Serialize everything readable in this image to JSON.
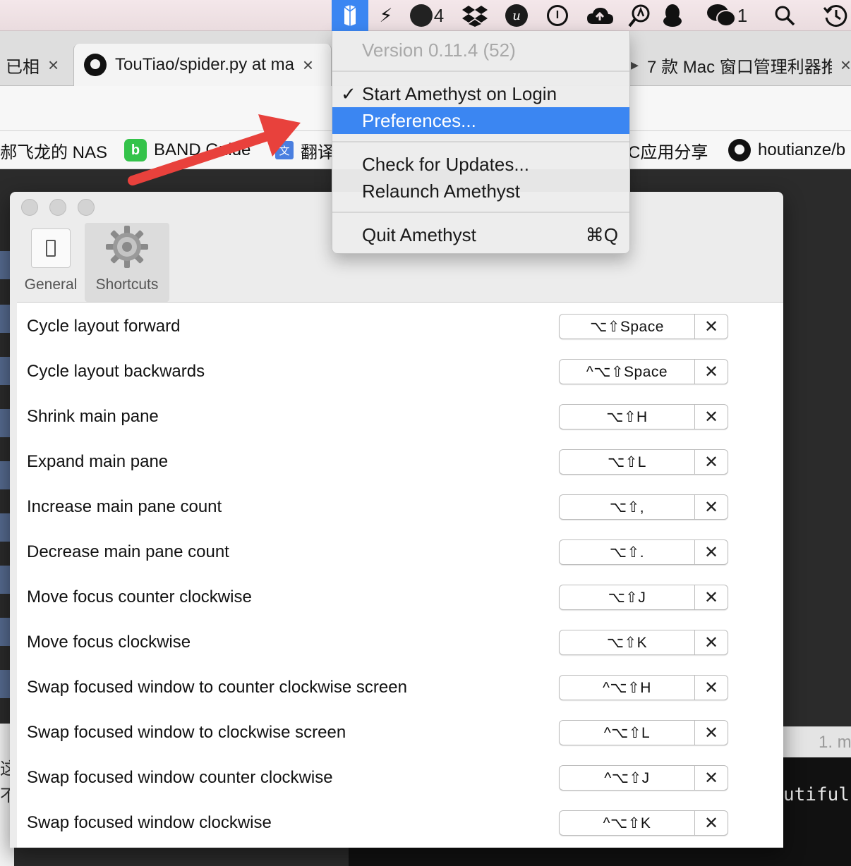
{
  "menubar": {
    "bolt_icon": "⚡",
    "extras_count": "4",
    "wechat_count": "1"
  },
  "tabs": {
    "left_partial": "已相",
    "github_tab": "TouTiao/spider.py at ma",
    "right_tab": "7 款 Mac 窗口管理利器推",
    "close": "×"
  },
  "bookmarks": {
    "nas": "郝飞龙的 NAS",
    "band": "BAND Guide",
    "translate": "翻译",
    "mac_app": "C应用分享",
    "github_user": "houtianze/b"
  },
  "menu": {
    "version": "Version 0.11.4 (52)",
    "start_on_login": "Start Amethyst on Login",
    "checkmark": "✓",
    "preferences": "Preferences...",
    "check_updates": "Check for Updates...",
    "relaunch": "Relaunch Amethyst",
    "quit": "Quit Amethyst",
    "quit_shortcut": "⌘Q"
  },
  "prefs": {
    "tabs": [
      {
        "label": "General"
      },
      {
        "label": "Shortcuts"
      }
    ],
    "clear_label": "✕",
    "shortcuts": [
      {
        "label": "Cycle layout forward",
        "keys": "⌥⇧Space"
      },
      {
        "label": "Cycle layout backwards",
        "keys": "^⌥⇧Space"
      },
      {
        "label": "Shrink main pane",
        "keys": "⌥⇧H"
      },
      {
        "label": "Expand main pane",
        "keys": "⌥⇧L"
      },
      {
        "label": "Increase main pane count",
        "keys": "⌥⇧,"
      },
      {
        "label": "Decrease main pane count",
        "keys": "⌥⇧."
      },
      {
        "label": "Move focus counter clockwise",
        "keys": "⌥⇧J"
      },
      {
        "label": "Move focus clockwise",
        "keys": "⌥⇧K"
      },
      {
        "label": "Swap focused window to counter clockwise screen",
        "keys": "^⌥⇧H"
      },
      {
        "label": "Swap focused window to clockwise screen",
        "keys": "^⌥⇧L"
      },
      {
        "label": "Swap focused window counter clockwise",
        "keys": "^⌥⇧J"
      },
      {
        "label": "Swap focused window clockwise",
        "keys": "^⌥⇧K"
      }
    ]
  },
  "background": {
    "terminal_tab": "1. m",
    "terminal_text": "utifuls",
    "left_chars": [
      "这",
      "不"
    ]
  },
  "colors": {
    "accent": "#3b86f2",
    "annotation_arrow": "#e8413c"
  }
}
